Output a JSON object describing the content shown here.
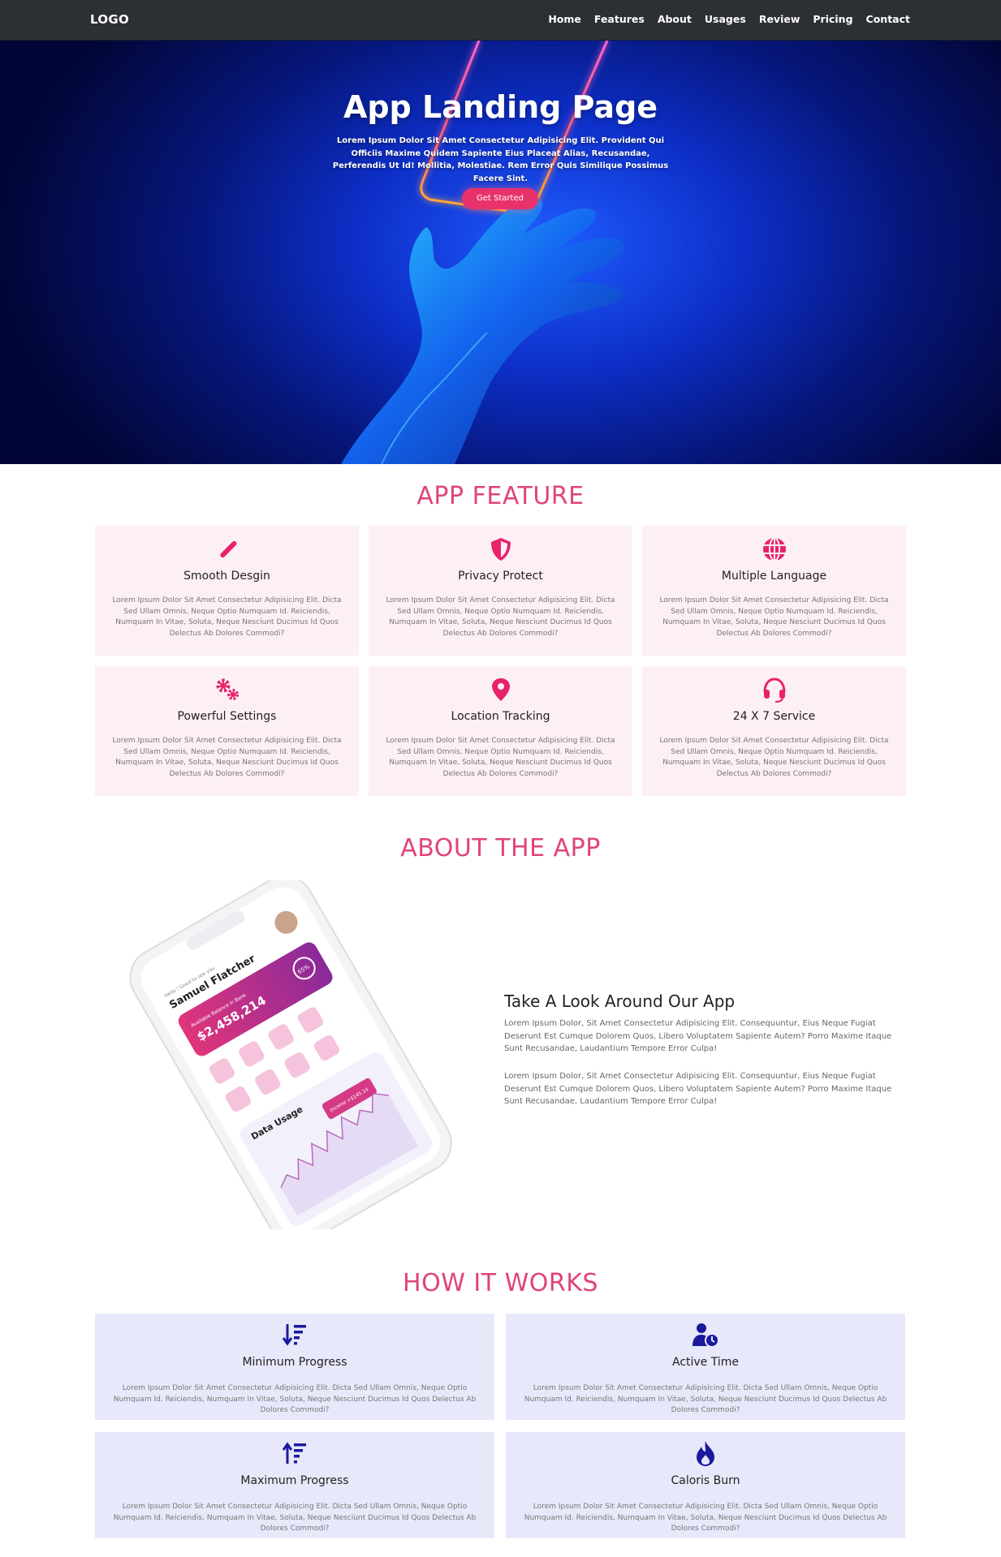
{
  "nav": {
    "logo": "LOGO",
    "items": [
      "Home",
      "Features",
      "About",
      "Usages",
      "Review",
      "Pricing",
      "Contact"
    ]
  },
  "hero": {
    "title": "App Landing Page",
    "text": "Lorem Ipsum Dolor Sit Amet Consectetur Adipisicing Elit. Provident Qui Officiis Maxime Quidem Sapiente Eius Placeat Alias, Recusandae, Perferendis Ut Id! Mollitia, Molestiae. Rem Error Quis Similique Possimus Facere Sint.",
    "button": "Get Started"
  },
  "features": {
    "title": "APP FEATURE",
    "desc": "Lorem Ipsum Dolor Sit Amet Consectetur Adipisicing Elit. Dicta Sed Ullam Omnis, Neque Optio Numquam Id. Reiciendis, Numquam In Vitae, Soluta, Neque Nesciunt Ducimus Id Quos Delectus Ab Dolores Commodi?",
    "items": [
      {
        "title": "Smooth Desgin",
        "icon": "magic-wand-icon"
      },
      {
        "title": "Privacy Protect",
        "icon": "shield-icon"
      },
      {
        "title": "Multiple Language",
        "icon": "globe-icon"
      },
      {
        "title": "Powerful Settings",
        "icon": "cogs-icon"
      },
      {
        "title": "Location Tracking",
        "icon": "map-pin-icon"
      },
      {
        "title": "24 X 7 Service",
        "icon": "headset-icon"
      }
    ]
  },
  "about": {
    "title": "ABOUT THE APP",
    "heading": "Take A Look Around Our App",
    "p1": "Lorem Ipsum Dolor, Sit Amet Consectetur Adipisicing Elit. Consequuntur, Eius Neque Fugiat Deserunt Est Cumque Dolorem Quos, Libero Voluptatem Sapiente Autem? Porro Maxime Itaque Sunt Recusandae, Laudantium Tempore Error Culpa!",
    "p2": "Lorem Ipsum Dolor, Sit Amet Consectetur Adipisicing Elit. Consequuntur, Eius Neque Fugiat Deserunt Est Cumque Dolorem Quos, Libero Voluptatem Sapiente Autem? Porro Maxime Itaque Sunt Recusandae, Laudantium Tempore Error Culpa!",
    "phone": {
      "greeting": "Hello ! Good to see you",
      "name": "Samuel Flatcher",
      "balance_label": "Available Balance in Bank",
      "balance": "$2,458,214",
      "percent": "65%",
      "chart_title": "Data Usage",
      "chart_badge": "Income +$145.14"
    }
  },
  "how": {
    "title": "HOW IT WORKS",
    "desc": "Lorem Ipsum Dolor Sit Amet Consectetur Adipisicing Elit. Dicta Sed Ullam Omnis, Neque Optio Numquam Id. Reiciendis, Numquam In Vitae, Soluta, Neque Nesciunt Ducimus Id Quos Delectus Ab Dolores Commodi?",
    "items": [
      {
        "title": "Minimum Progress",
        "icon": "sort-down-icon"
      },
      {
        "title": "Active Time",
        "icon": "user-clock-icon"
      },
      {
        "title": "Maximum Progress",
        "icon": "sort-up-icon"
      },
      {
        "title": "Caloris Burn",
        "icon": "fire-icon"
      }
    ]
  },
  "colors": {
    "accent": "#e0447a",
    "nav_bg": "#2c2f34",
    "feature_card_bg": "#fdf0f5",
    "how_card_bg": "#e8e8fb",
    "how_icon": "#1a1a9e"
  }
}
